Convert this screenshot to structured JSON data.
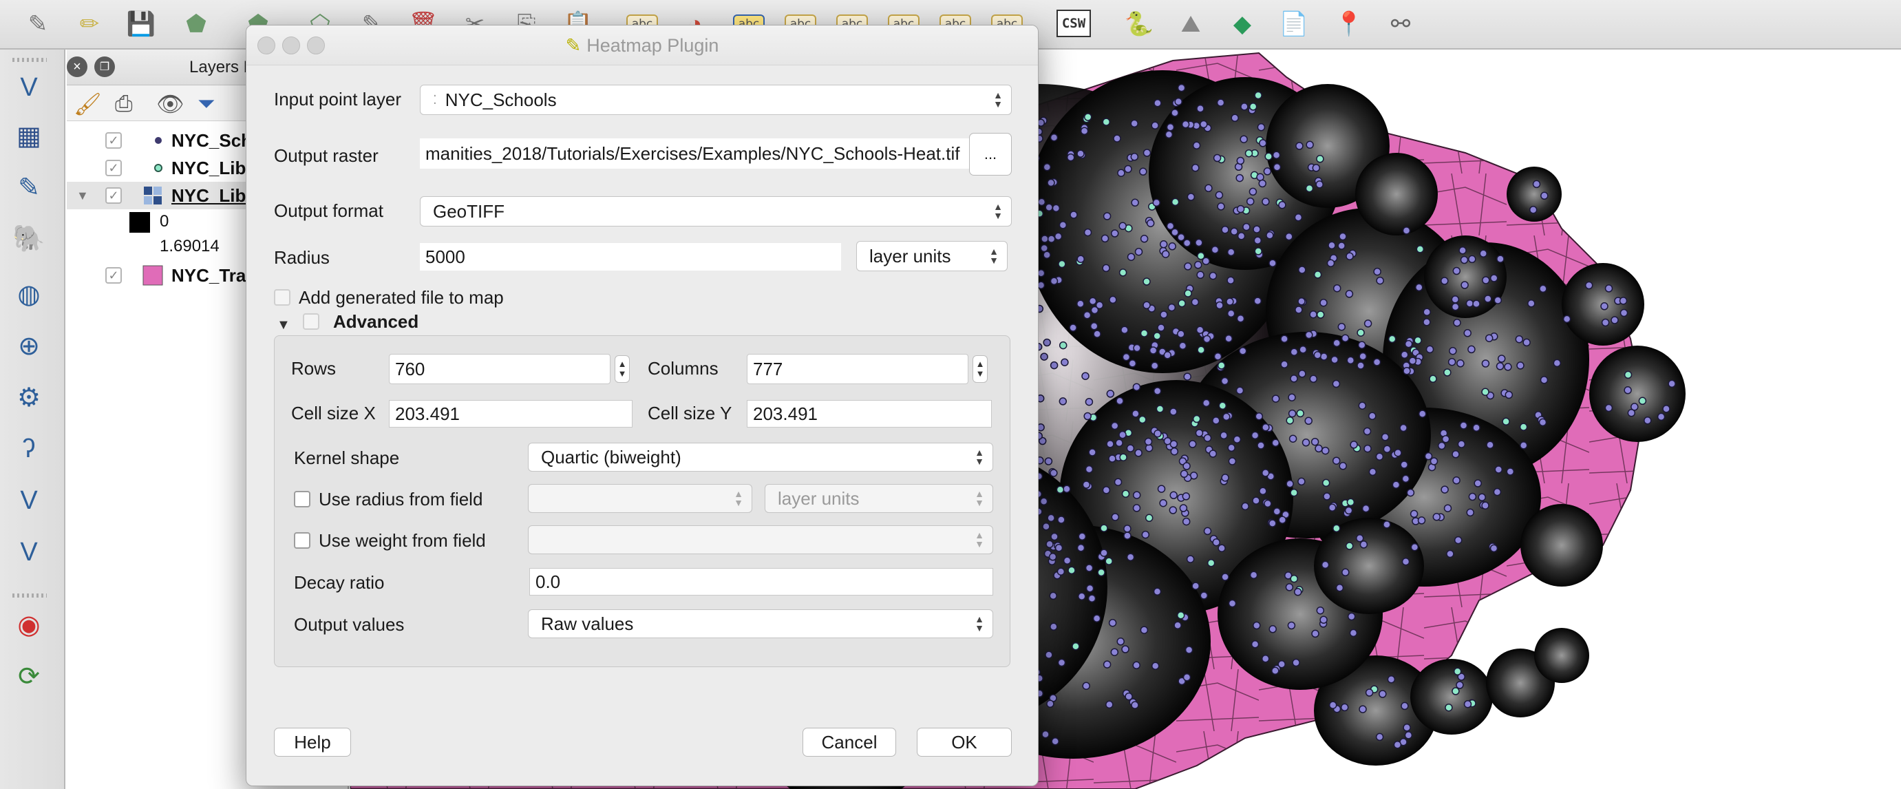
{
  "dialog": {
    "title": "Heatmap Plugin",
    "input_point_layer_label": "Input point layer",
    "input_point_layer_value": "NYC_Schools",
    "output_raster_label": "Output raster",
    "output_raster_value": "manities_2018/Tutorials/Exercises/Examples/NYC_Schools-Heat.tif",
    "browse_label": "...",
    "output_format_label": "Output format",
    "output_format_value": "GeoTIFF",
    "radius_label": "Radius",
    "radius_value": "5000",
    "radius_units": "layer units",
    "add_to_map_label": "Add generated file to map",
    "advanced_label": "Advanced",
    "advanced": {
      "rows_label": "Rows",
      "rows_value": "760",
      "columns_label": "Columns",
      "columns_value": "777",
      "cell_size_x_label": "Cell size X",
      "cell_size_x_value": "203.491",
      "cell_size_y_label": "Cell size Y",
      "cell_size_y_value": "203.491",
      "kernel_shape_label": "Kernel shape",
      "kernel_shape_value": "Quartic (biweight)",
      "use_radius_label": "Use radius from field",
      "use_radius_units": "layer units",
      "use_weight_label": "Use weight from field",
      "decay_ratio_label": "Decay ratio",
      "decay_ratio_value": "0.0",
      "output_values_label": "Output values",
      "output_values_value": "Raw values"
    },
    "help_label": "Help",
    "cancel_label": "Cancel",
    "ok_label": "OK"
  },
  "layers_panel": {
    "title": "Layers P",
    "layers": [
      {
        "name": "NYC_Sch",
        "checked": true
      },
      {
        "name": "NYC_Lib",
        "checked": true
      },
      {
        "name": "NYC_Lib",
        "checked": true
      },
      {
        "name": "NYC_Tra",
        "checked": true
      }
    ],
    "legend_min": "0",
    "legend_max": "1.69014"
  },
  "toolbar": {
    "abc_label": "abc",
    "csw_label": "CSW"
  },
  "colors": {
    "map_fill": "#e06cb8",
    "point_fill": "#8b84d6",
    "point_highlight": "#8fe8c8",
    "dialog_bg": "#ececec"
  }
}
